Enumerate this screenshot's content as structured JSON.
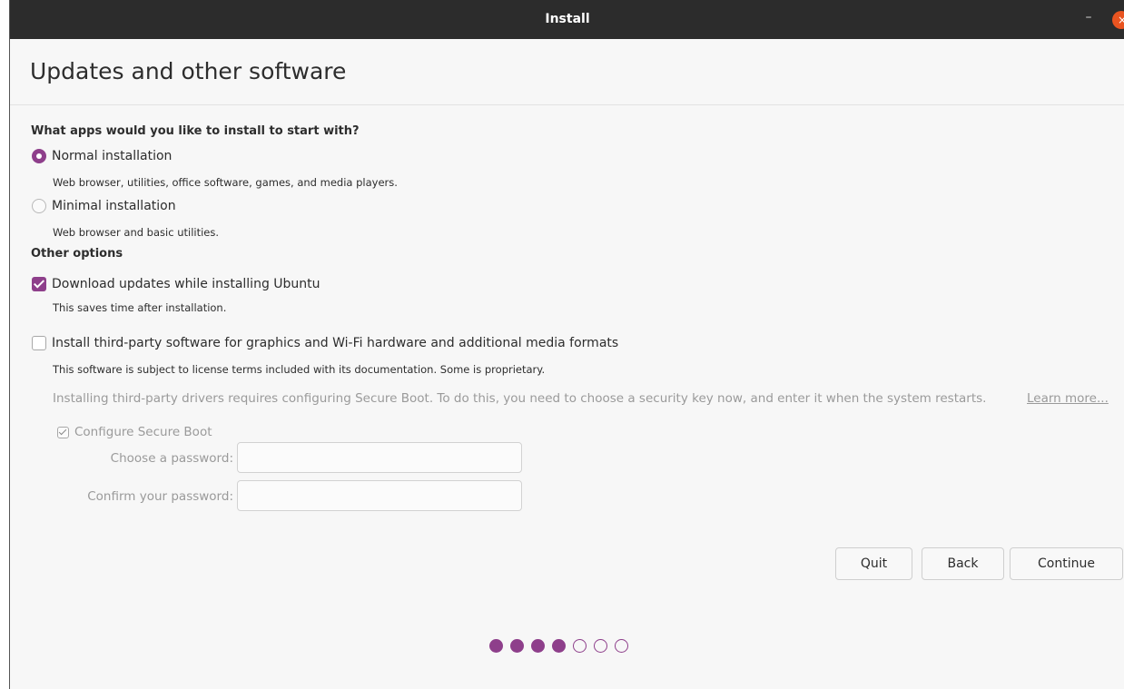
{
  "window": {
    "title": "Install",
    "minimize_icon": "minimize-icon",
    "close_icon": "close-icon",
    "minimize_glyph": "–",
    "close_glyph": "×"
  },
  "page": {
    "title": "Updates and other software"
  },
  "apps_section": {
    "heading": "What apps would you like to install to start with?",
    "options": [
      {
        "label": "Normal installation",
        "description": "Web browser, utilities, office software, games, and media players.",
        "selected": true
      },
      {
        "label": "Minimal installation",
        "description": "Web browser and basic utilities.",
        "selected": false
      }
    ]
  },
  "other_section": {
    "heading": "Other options",
    "download_updates": {
      "label": "Download updates while installing Ubuntu",
      "description": "This saves time after installation.",
      "checked": true
    },
    "third_party": {
      "label": "Install third-party software for graphics and Wi-Fi hardware and additional media formats",
      "description": "This software is subject to license terms included with its documentation. Some is proprietary.",
      "checked": false
    },
    "secure_boot_note": "Installing third-party drivers requires configuring Secure Boot. To do this, you need to choose a security key now, and enter it when the system restarts.",
    "learn_more": "Learn more...",
    "configure_secure_boot": {
      "label": "Configure Secure Boot",
      "checked": true,
      "enabled": false
    },
    "password_label": "Choose a password:",
    "confirm_label": "Confirm your password:",
    "password_value": "",
    "confirm_value": ""
  },
  "buttons": {
    "quit": "Quit",
    "back": "Back",
    "continue": "Continue"
  },
  "progress": {
    "completed_steps": 4,
    "total_steps": 7
  },
  "colors": {
    "accent": "#8e3f8b",
    "close": "#e95420",
    "titlebar": "#2c2c2c",
    "background": "#f7f7f7"
  }
}
